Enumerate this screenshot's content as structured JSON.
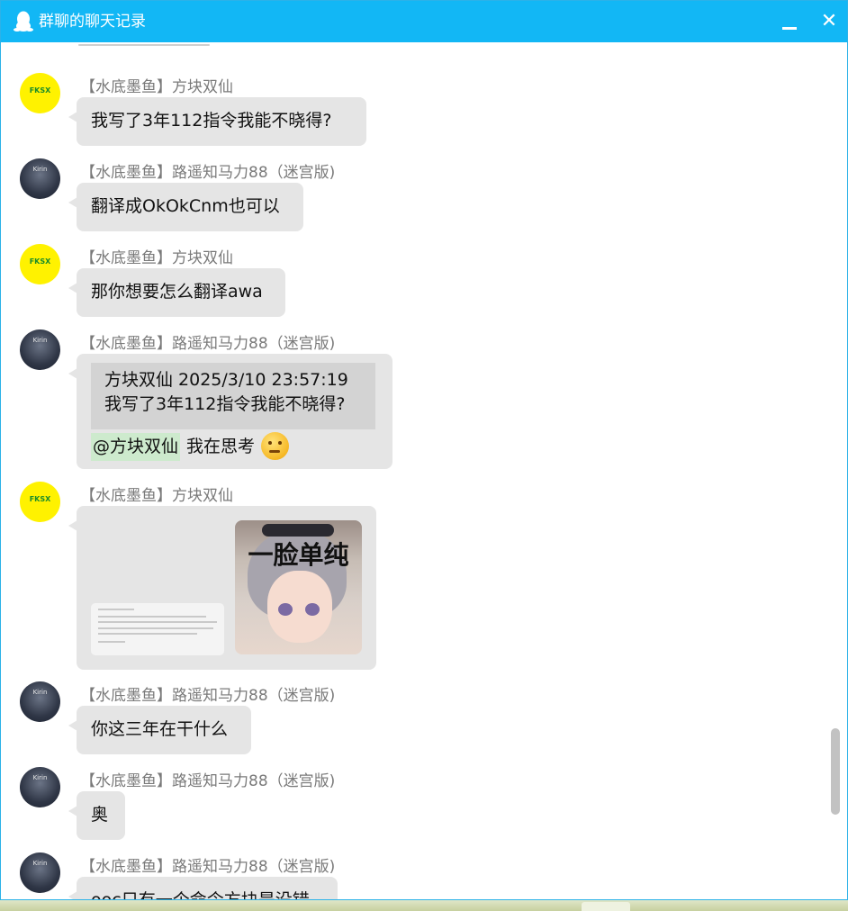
{
  "window": {
    "title": "群聊的聊天记录",
    "icons": {
      "app": "qq-penguin-icon",
      "minimize": "minimize-icon",
      "close": "close-icon"
    },
    "close_glyph": "✕"
  },
  "colors": {
    "titlebar": "#12b7f5",
    "bubble": "#e5e5e5",
    "quote": "#d3d3d3",
    "mention_bg": "#cdeacd",
    "sender_text": "#7a7a7a"
  },
  "avatars": {
    "fangkuai": {
      "icon": "fksx-avatar",
      "text": "FKSX"
    },
    "luyao": {
      "icon": "kirin-avatar",
      "text": "Kirin"
    }
  },
  "messages": [
    {
      "sender": "【水底墨鱼】方块双仙",
      "text": "我写了3年112指令我能不晓得?"
    },
    {
      "sender": "【水底墨鱼】路遥知马力88（迷宫版)",
      "text": "翻译成OkOkCnm也可以"
    },
    {
      "sender": "【水底墨鱼】方块双仙",
      "text": "那你想要怎么翻译awa"
    },
    {
      "sender": "【水底墨鱼】路遥知马力88（迷宫版)",
      "quote": {
        "header": "方块双仙  2025/3/10 23:57:19",
        "text": "我写了3年112指令我能不晓得?"
      },
      "mention": "@方块双仙",
      "text": "我在思考",
      "emoji": "thinking-face-emoji"
    },
    {
      "sender": "【水底墨鱼】方块双仙",
      "images": [
        {
          "icon": "document-screenshot-image"
        },
        {
          "icon": "anime-girl-sticker-image",
          "text": "一脸单纯"
        }
      ]
    },
    {
      "sender": "【水底墨鱼】路遥知马力88（迷宫版)",
      "text": "你这三年在干什么"
    },
    {
      "sender": "【水底墨鱼】路遥知马力88（迷宫版)",
      "text": "奥"
    },
    {
      "sender": "【水底墨鱼】路遥知马力88（迷宫版)",
      "text": "ooc只有一个命令方块是没错"
    }
  ]
}
